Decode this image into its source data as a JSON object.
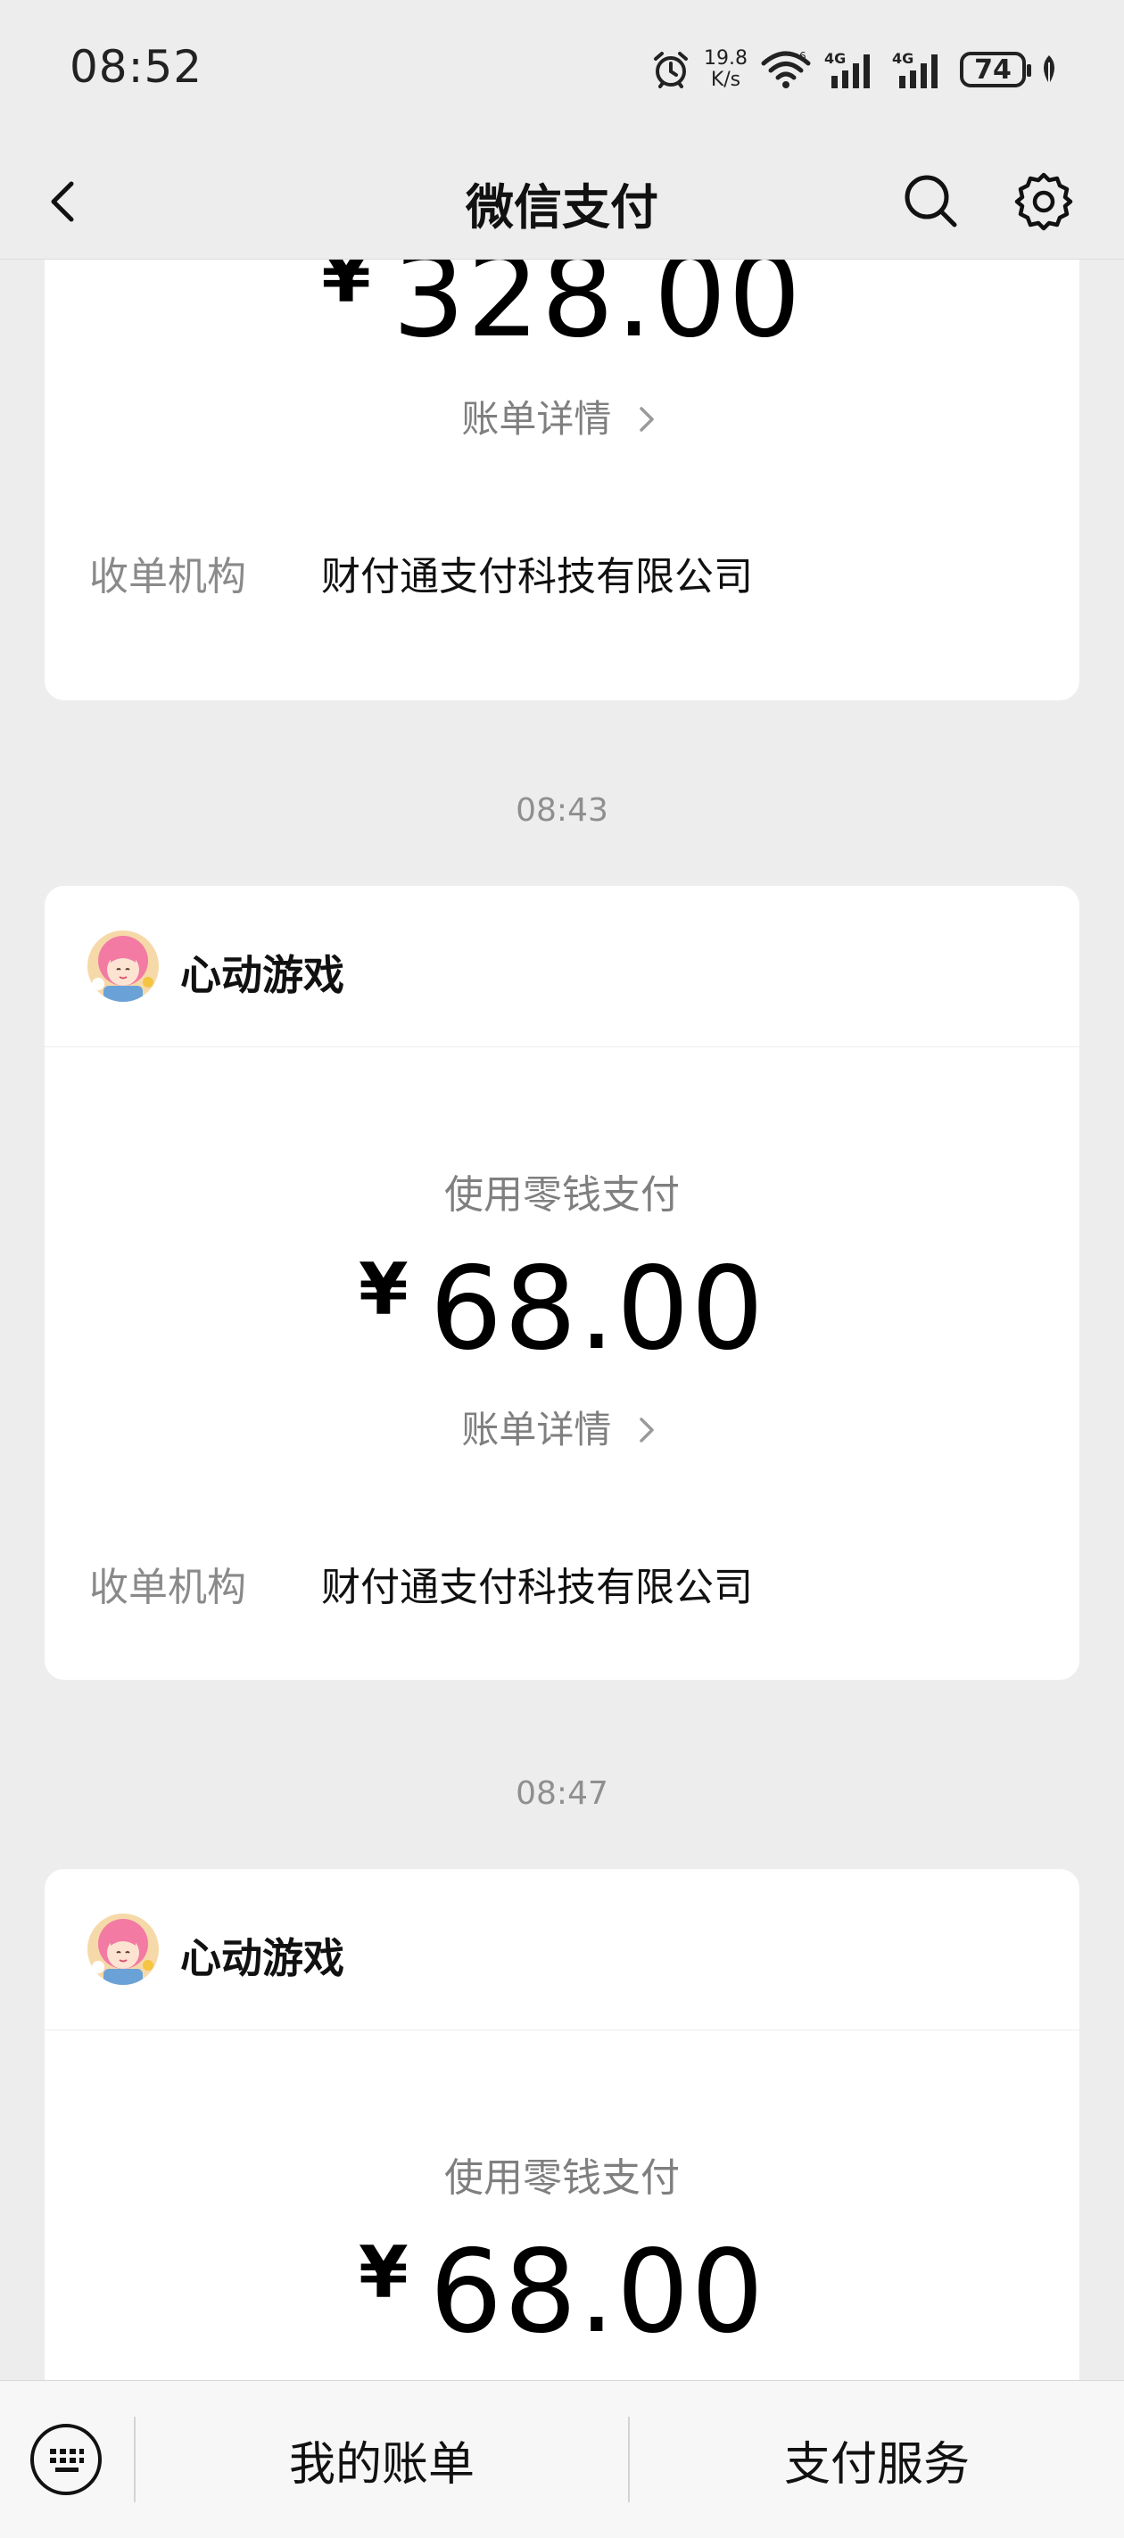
{
  "status_bar": {
    "time": "08:52",
    "net_speed_value": "19.8",
    "net_speed_unit": "K/s",
    "signal_1": "4G",
    "signal_2": "4G",
    "battery": "74"
  },
  "header": {
    "title": "微信支付"
  },
  "feed": {
    "cards": [
      {
        "amount": "328.00",
        "currency_symbol": "¥",
        "detail_link": "账单详情",
        "org_label": "收单机构",
        "org_value": "财付通支付科技有限公司"
      },
      {
        "time": "08:43",
        "merchant": "心动游戏",
        "pay_method": "使用零钱支付",
        "currency_symbol": "¥",
        "amount": "68.00",
        "detail_link": "账单详情",
        "org_label": "收单机构",
        "org_value": "财付通支付科技有限公司"
      },
      {
        "time": "08:47",
        "merchant": "心动游戏",
        "pay_method": "使用零钱支付",
        "currency_symbol": "¥",
        "amount": "68.00"
      }
    ]
  },
  "bottom_bar": {
    "tab_bills": "我的账单",
    "tab_services": "支付服务"
  },
  "icons": {
    "back": "chevron-left-icon",
    "search": "search-icon",
    "settings": "gear-icon",
    "keyboard": "keyboard-icon",
    "alarm": "alarm-icon",
    "wifi": "wifi-icon",
    "leaf": "leaf-icon"
  },
  "colors": {
    "background": "#ededed",
    "card": "#ffffff",
    "secondary_text": "#7f7f7f"
  }
}
